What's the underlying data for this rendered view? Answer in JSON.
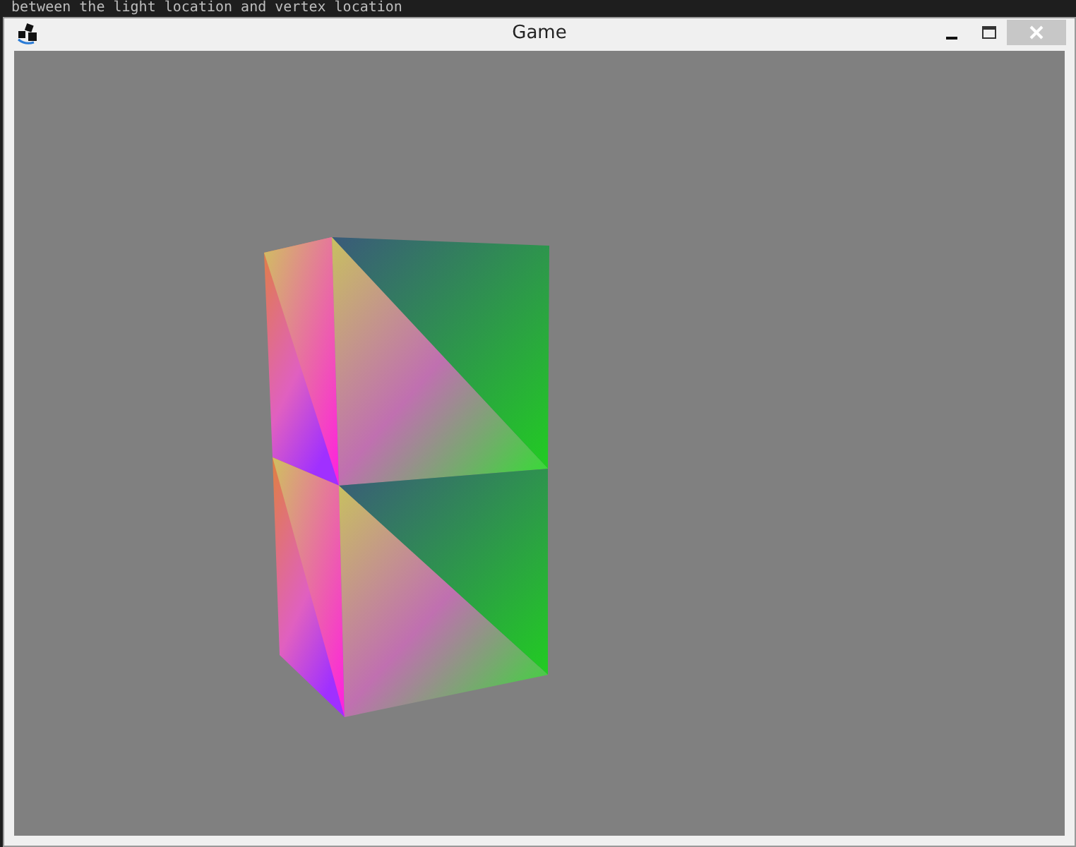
{
  "background_window": {
    "text": "between the light location and vertex location"
  },
  "window": {
    "title": "Game"
  }
}
